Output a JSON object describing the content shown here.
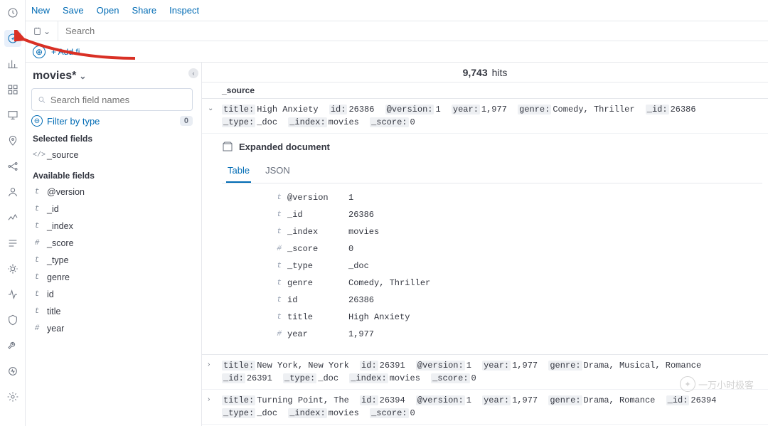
{
  "top_menu": {
    "new": "New",
    "save": "Save",
    "open": "Open",
    "share": "Share",
    "inspect": "Inspect"
  },
  "search": {
    "placeholder": "Search"
  },
  "add_filter": {
    "label": "+ Add fi..."
  },
  "index_pattern": {
    "name": "movies*",
    "collapse_glyph": "‹"
  },
  "field_search": {
    "placeholder": "Search field names"
  },
  "filter_type": {
    "label": "Filter by type",
    "count": "0"
  },
  "sections": {
    "selected": "Selected fields",
    "available": "Available fields"
  },
  "selected_fields": [
    {
      "type": "code",
      "type_glyph": "</>",
      "name": "_source"
    }
  ],
  "available_fields": [
    {
      "type": "t",
      "type_glyph": "t",
      "name": "@version"
    },
    {
      "type": "t",
      "type_glyph": "t",
      "name": "_id"
    },
    {
      "type": "t",
      "type_glyph": "t",
      "name": "_index"
    },
    {
      "type": "n",
      "type_glyph": "#",
      "name": "_score"
    },
    {
      "type": "t",
      "type_glyph": "t",
      "name": "_type"
    },
    {
      "type": "t",
      "type_glyph": "t",
      "name": "genre"
    },
    {
      "type": "t",
      "type_glyph": "t",
      "name": "id"
    },
    {
      "type": "t",
      "type_glyph": "t",
      "name": "title"
    },
    {
      "type": "n",
      "type_glyph": "#",
      "name": "year"
    }
  ],
  "hits": {
    "count": "9,743",
    "label": "hits"
  },
  "columns": {
    "source": "_source"
  },
  "expanded": {
    "header": "Expanded document",
    "tab_table": "Table",
    "tab_json": "JSON"
  },
  "doc1": {
    "summary": {
      "title_k": "title:",
      "title_v": "High Anxiety",
      "id_k": "id:",
      "id_v": "26386",
      "version_k": "@version:",
      "version_v": "1",
      "year_k": "year:",
      "year_v": "1,977",
      "genre_k": "genre:",
      "genre_v": "Comedy, Thriller",
      "uid_k": "_id:",
      "uid_v": "26386",
      "type_k": "_type:",
      "type_v": "_doc",
      "index_k": "_index:",
      "index_v": "movies",
      "score_k": "_score:",
      "score_v": "0"
    },
    "table": [
      {
        "t": "t",
        "k": "@version",
        "v": "1"
      },
      {
        "t": "t",
        "k": "_id",
        "v": "26386"
      },
      {
        "t": "t",
        "k": "_index",
        "v": "movies"
      },
      {
        "t": "#",
        "k": "_score",
        "v": "0"
      },
      {
        "t": "t",
        "k": "_type",
        "v": "_doc"
      },
      {
        "t": "t",
        "k": "genre",
        "v": "Comedy, Thriller"
      },
      {
        "t": "t",
        "k": "id",
        "v": "26386"
      },
      {
        "t": "t",
        "k": "title",
        "v": "High Anxiety"
      },
      {
        "t": "#",
        "k": "year",
        "v": "1,977"
      }
    ]
  },
  "doc2": {
    "title_k": "title:",
    "title_v": "New York, New York",
    "id_k": "id:",
    "id_v": "26391",
    "version_k": "@version:",
    "version_v": "1",
    "year_k": "year:",
    "year_v": "1,977",
    "genre_k": "genre:",
    "genre_v": "Drama, Musical, Romance",
    "uid_k": "_id:",
    "uid_v": "26391",
    "type_k": "_type:",
    "type_v": "_doc",
    "index_k": "_index:",
    "index_v": "movies",
    "score_k": "_score:",
    "score_v": "0"
  },
  "doc3": {
    "title_k": "title:",
    "title_v": "Turning Point, The",
    "id_k": "id:",
    "id_v": "26394",
    "version_k": "@version:",
    "version_v": "1",
    "year_k": "year:",
    "year_v": "1,977",
    "genre_k": "genre:",
    "genre_v": "Drama, Romance",
    "uid_k": "_id:",
    "uid_v": "26394",
    "type_k": "_type:",
    "type_v": "_doc",
    "index_k": "_index:",
    "index_v": "movies",
    "score_k": "_score:",
    "score_v": "0"
  },
  "watermark": {
    "text": "一万小时极客"
  }
}
